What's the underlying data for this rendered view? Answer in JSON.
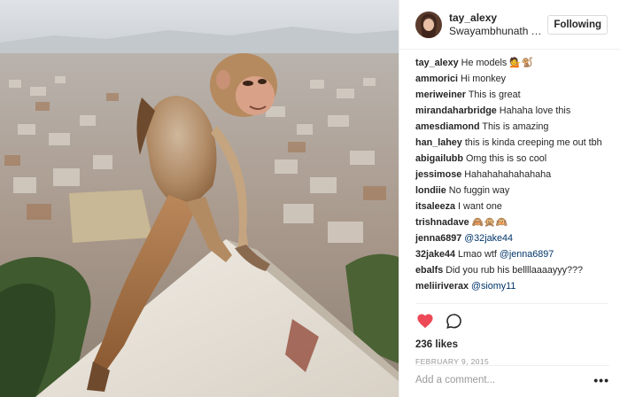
{
  "post": {
    "username": "tay_alexy",
    "location": "Swayambhunath Temple",
    "follow_label": "Following",
    "likes": "236 likes",
    "date": "FEBRUARY 9, 2015",
    "add_comment_placeholder": "Add a comment...",
    "more_label": "•••"
  },
  "comments": [
    {
      "user": "tay_alexy",
      "text": "He models 💁🐒"
    },
    {
      "user": "ammorici",
      "text": "Hi monkey"
    },
    {
      "user": "meriweiner",
      "text": "This is great"
    },
    {
      "user": "mirandaharbridge",
      "text": "Hahaha love this"
    },
    {
      "user": "amesdiamond",
      "text": "This is amazing"
    },
    {
      "user": "han_lahey",
      "text": "this is kinda creeping me out tbh"
    },
    {
      "user": "abigailubb",
      "text": "Omg this is so cool"
    },
    {
      "user": "jessimose",
      "text": "Hahahahahahahaha"
    },
    {
      "user": "londiie",
      "text": "No fuggin way"
    },
    {
      "user": "itsaleeza",
      "text": "I want one"
    },
    {
      "user": "trishnadave",
      "text": "🙈🙊🙉"
    },
    {
      "user": "jenna6897",
      "mention": "@32jake44"
    },
    {
      "user": "32jake44",
      "text": "Lmao wtf ",
      "mention": "@jenna6897"
    },
    {
      "user": "ebalfs",
      "text": "Did you rub his bellllaaaayyy???"
    },
    {
      "user": "meliiriverax",
      "mention": "@siomy11"
    }
  ],
  "colors": {
    "heart": "#ed4956",
    "mention": "#003569",
    "muted": "#999999",
    "border": "#efefef"
  },
  "icons": {
    "like": "heart-icon",
    "comment": "comment-bubble-icon"
  }
}
